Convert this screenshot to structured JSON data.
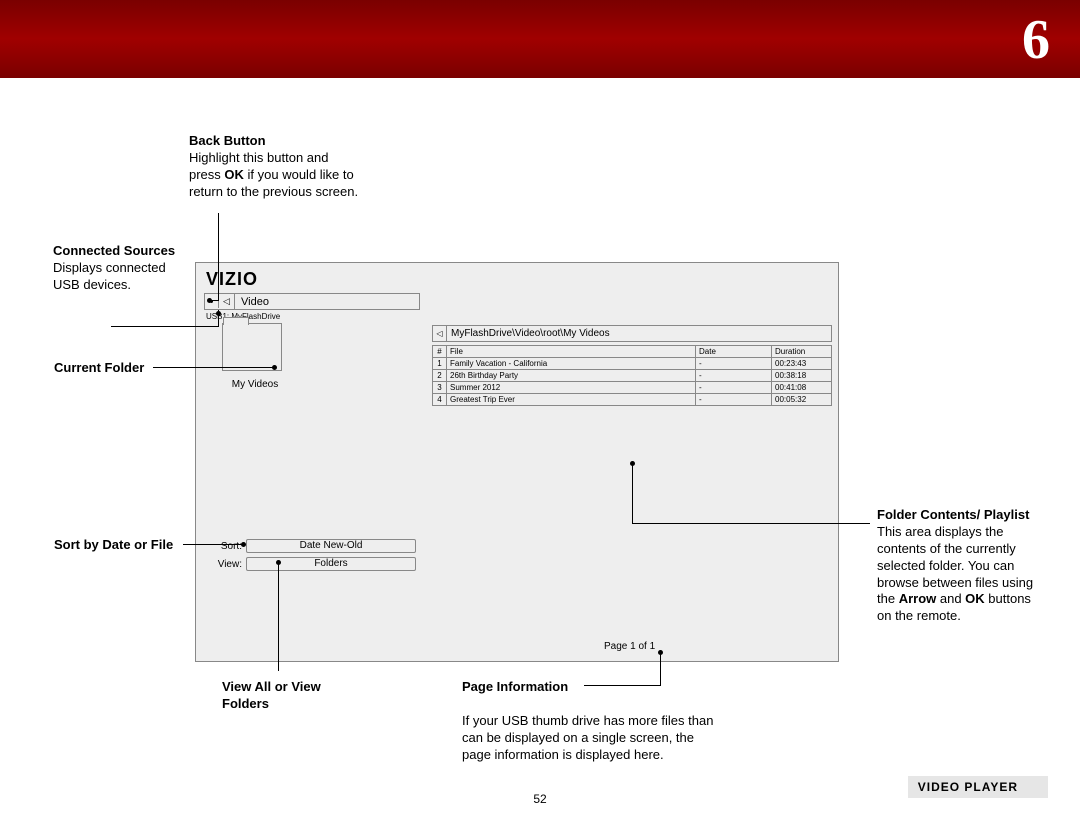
{
  "chapter": "6",
  "callouts": {
    "back_title": "Back Button",
    "back_body1": "Highlight this button and press ",
    "back_ok": "OK",
    "back_body2": " if you would like to return to the previous screen.",
    "sources_title": "Connected Sources",
    "sources_body": "Displays connected USB devices.",
    "current_folder": "Current Folder",
    "sort_label": "Sort by Date or File",
    "view_label": "View All or View Folders",
    "page_title": "Page Information",
    "page_body": "If your USB thumb drive has more files than can be displayed on a single screen, the page information is displayed here.",
    "contents_title": "Folder Contents/ Playlist",
    "contents_body1": "This area displays the contents of the currently selected folder. You can browse between files using the ",
    "contents_arrow": "Arrow",
    "contents_and": " and ",
    "contents_ok": "OK",
    "contents_body2": " buttons on the remote."
  },
  "tv": {
    "logo": "VIZIO",
    "section": "Video",
    "source": "USB1: MyFlashDrive",
    "folder_name": "My Videos",
    "sort_lbl": "Sort:",
    "sort_val": "Date New-Old",
    "view_lbl": "View:",
    "view_val": "Folders",
    "path": "MyFlashDrive\\Video\\root\\My Videos",
    "headers": {
      "num": "#",
      "file": "File",
      "date": "Date",
      "dur": "Duration"
    },
    "rows": [
      {
        "n": "1",
        "file": "Family Vacation - California",
        "date": "-",
        "dur": "00:23:43"
      },
      {
        "n": "2",
        "file": "26th Birthday Party",
        "date": "-",
        "dur": "00:38:18"
      },
      {
        "n": "3",
        "file": "Summer 2012",
        "date": "-",
        "dur": "00:41:08"
      },
      {
        "n": "4",
        "file": "Greatest Trip Ever",
        "date": "-",
        "dur": "00:05:32"
      }
    ],
    "page": "Page 1 of 1"
  },
  "page_number": "52",
  "badge": "VIDEO PLAYER"
}
